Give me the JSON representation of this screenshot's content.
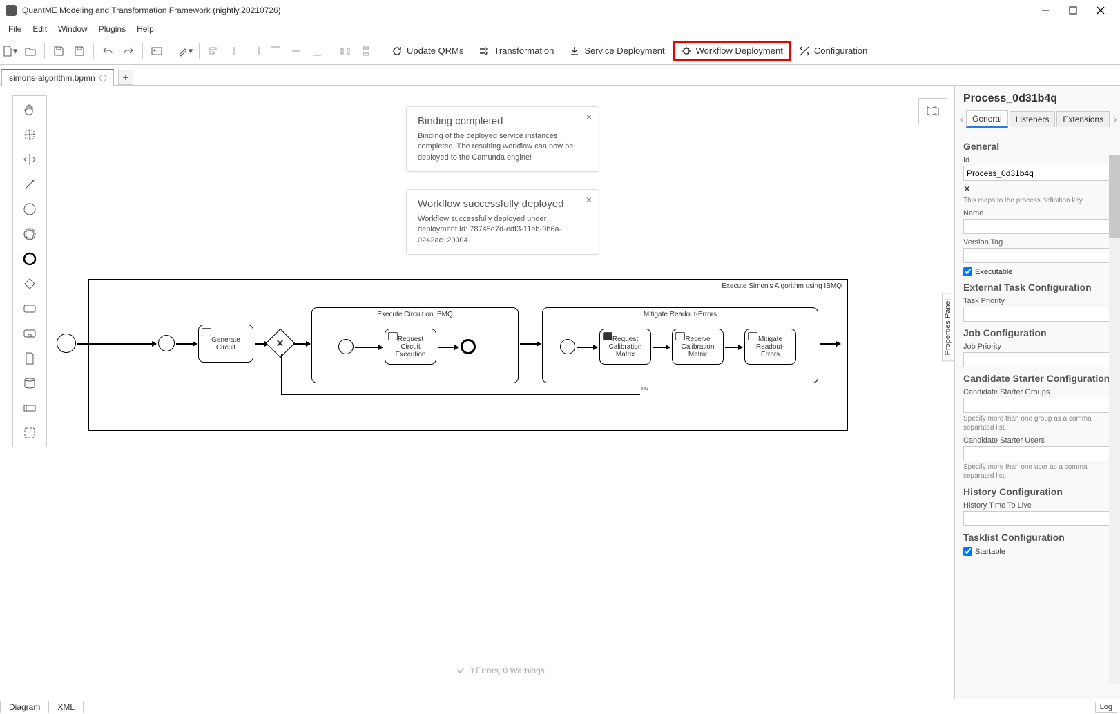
{
  "titlebar": {
    "title": "QuantME Modeling and Transformation Framework (nightly.20210726)"
  },
  "menus": [
    "File",
    "Edit",
    "Window",
    "Plugins",
    "Help"
  ],
  "toolbar_actions": {
    "update_qrms": "Update QRMs",
    "transformation": "Transformation",
    "service_deployment": "Service Deployment",
    "workflow_deployment": "Workflow Deployment",
    "configuration": "Configuration"
  },
  "tab": {
    "name": "simons-algorithm.bpmn"
  },
  "notifications": [
    {
      "title": "Binding completed",
      "body": "Binding of the deployed service instances completed. The resulting workflow can now be deployed to the Camunda engine!"
    },
    {
      "title": "Workflow successfully deployed",
      "body": "Workflow successfully deployed under deployment Id: 78745e7d-edf3-11eb-9b6a-0242ac120004"
    }
  ],
  "diagram": {
    "pool_label": "Execute Simon's Algorithm using IBMQ",
    "task1": "Generate Circuit",
    "sub1": {
      "label": "Execute Circuit on IBMQ",
      "task": "Request Circuit Execution"
    },
    "sub2": {
      "label": "Mitigate Readout-Errors",
      "t1": "Request Calibration Matrix",
      "t2": "Receive Calibration Matrix",
      "t3": "Mitigate Readout-Errors"
    },
    "no": "no"
  },
  "props_handle": "Properties Panel",
  "properties": {
    "title": "Process_0d31b4q",
    "tabs": [
      "General",
      "Listeners",
      "Extensions"
    ],
    "section_general": "General",
    "id_label": "Id",
    "id_value": "Process_0d31b4q",
    "id_hint": "This maps to the process definition key.",
    "name_label": "Name",
    "version_label": "Version Tag",
    "executable": "Executable",
    "ext_task": "External Task Configuration",
    "task_priority": "Task Priority",
    "job_conf": "Job Configuration",
    "job_priority": "Job Priority",
    "cand_starter": "Candidate Starter Configuration",
    "cs_groups": "Candidate Starter Groups",
    "cs_groups_hint": "Specify more than one group as a comma separated list.",
    "cs_users": "Candidate Starter Users",
    "cs_users_hint": "Specify more than one user as a comma separated list.",
    "history_conf": "History Configuration",
    "history_ttl": "History Time To Live",
    "tasklist_conf": "Tasklist Configuration",
    "startable": "Startable"
  },
  "bottom_tabs": [
    "Diagram",
    "XML"
  ],
  "log": "Log",
  "errors": "0 Errors, 0 Warnings"
}
